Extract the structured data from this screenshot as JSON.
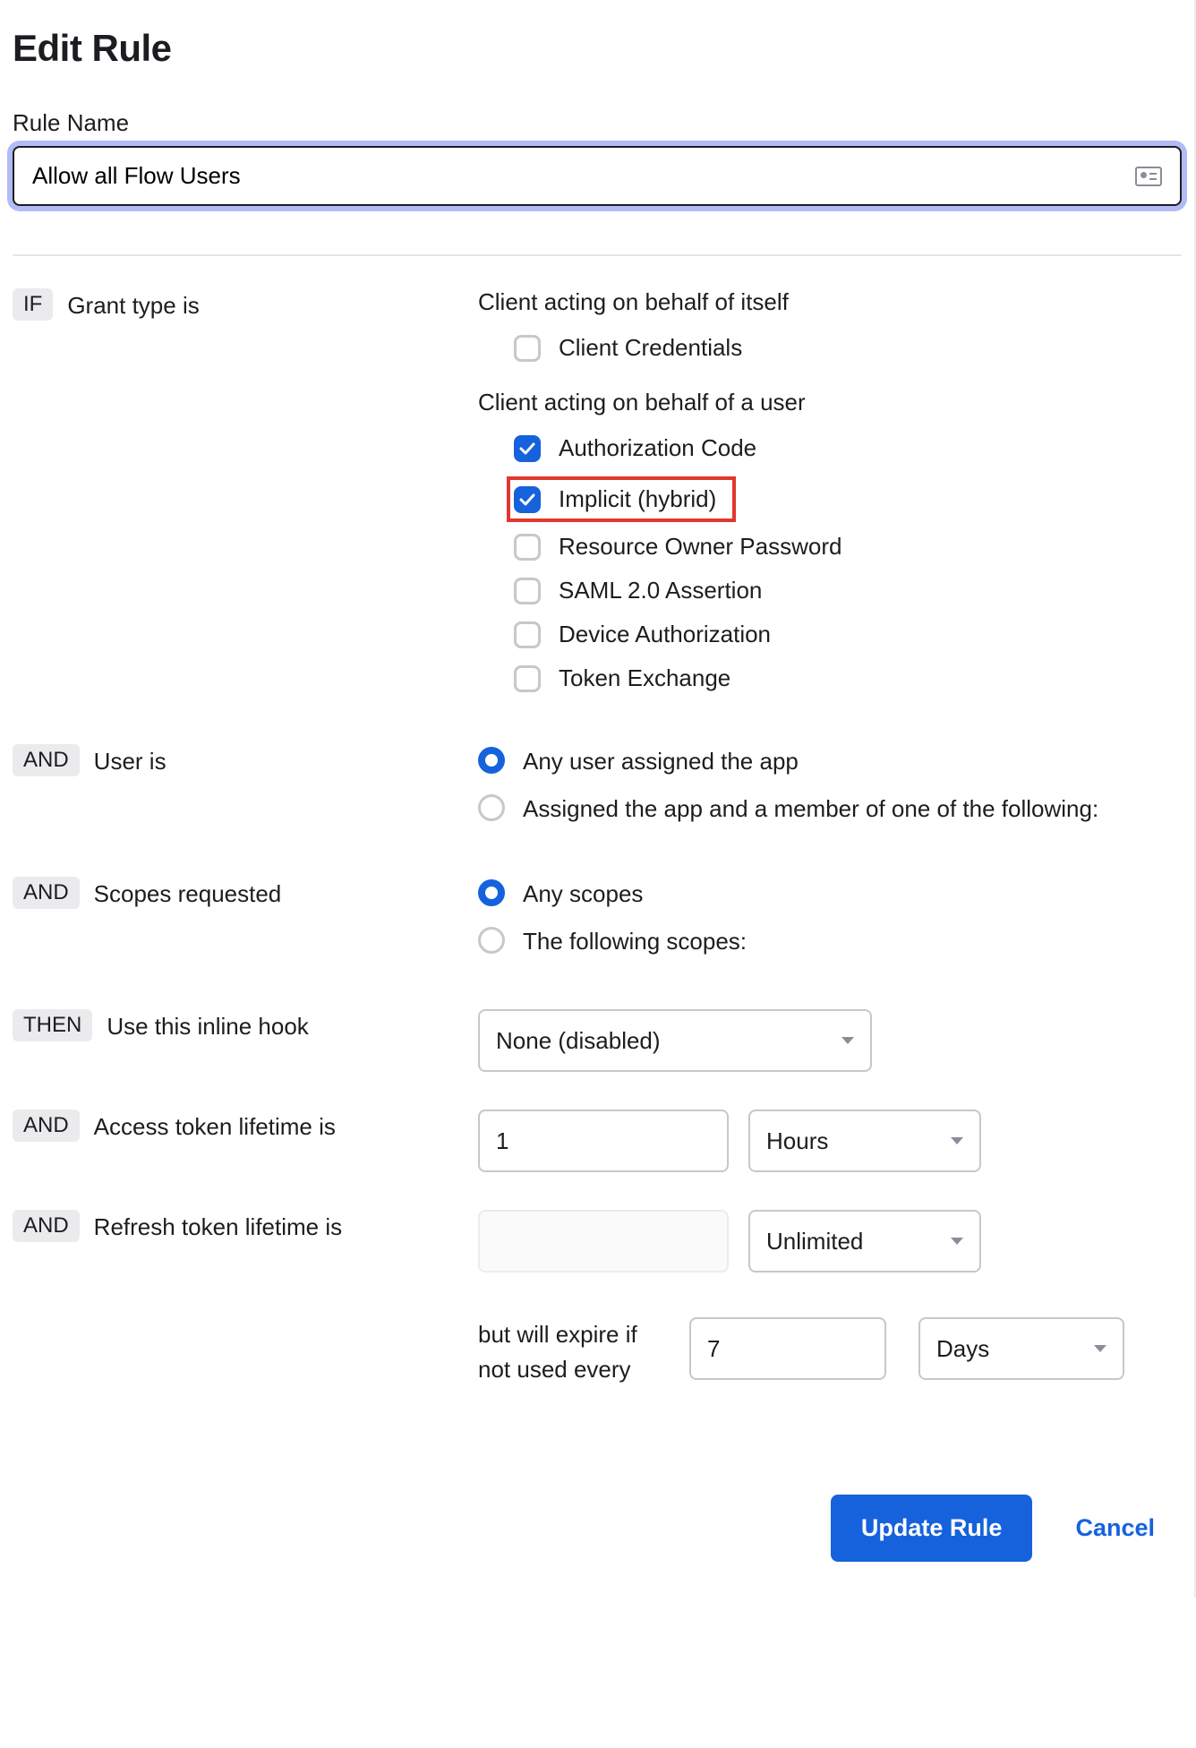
{
  "title": "Edit Rule",
  "ruleName": {
    "label": "Rule Name",
    "value": "Allow all Flow Users"
  },
  "sections": {
    "grantType": {
      "tag": "IF",
      "label": "Grant type is",
      "group1": {
        "heading": "Client acting on behalf of itself",
        "options": [
          {
            "key": "client_credentials",
            "label": "Client Credentials",
            "checked": false
          }
        ]
      },
      "group2": {
        "heading": "Client acting on behalf of a user",
        "options": [
          {
            "key": "authorization_code",
            "label": "Authorization Code",
            "checked": true,
            "highlight": false
          },
          {
            "key": "implicit_hybrid",
            "label": "Implicit (hybrid)",
            "checked": true,
            "highlight": true
          },
          {
            "key": "resource_owner_password",
            "label": "Resource Owner Password",
            "checked": false
          },
          {
            "key": "saml_2_assertion",
            "label": "SAML 2.0 Assertion",
            "checked": false
          },
          {
            "key": "device_authorization",
            "label": "Device Authorization",
            "checked": false
          },
          {
            "key": "token_exchange",
            "label": "Token Exchange",
            "checked": false
          }
        ]
      }
    },
    "userIs": {
      "tag": "AND",
      "label": "User is",
      "options": [
        {
          "key": "any_user",
          "label": "Any user assigned the app",
          "selected": true
        },
        {
          "key": "member_of",
          "label": "Assigned the app and a member of one of the following:",
          "selected": false
        }
      ]
    },
    "scopes": {
      "tag": "AND",
      "label": "Scopes requested",
      "options": [
        {
          "key": "any",
          "label": "Any scopes",
          "selected": true
        },
        {
          "key": "following",
          "label": "The following scopes:",
          "selected": false
        }
      ]
    },
    "inlineHook": {
      "tag": "THEN",
      "label": "Use this inline hook",
      "value": "None (disabled)"
    },
    "accessToken": {
      "tag": "AND",
      "label": "Access token lifetime is",
      "value": "1",
      "unit": "Hours"
    },
    "refreshToken": {
      "tag": "AND",
      "label": "Refresh token lifetime is",
      "value": "",
      "unit": "Unlimited",
      "expire": {
        "label": "but will expire if not used every",
        "value": "7",
        "unit": "Days"
      }
    }
  },
  "footer": {
    "update": "Update Rule",
    "cancel": "Cancel"
  }
}
